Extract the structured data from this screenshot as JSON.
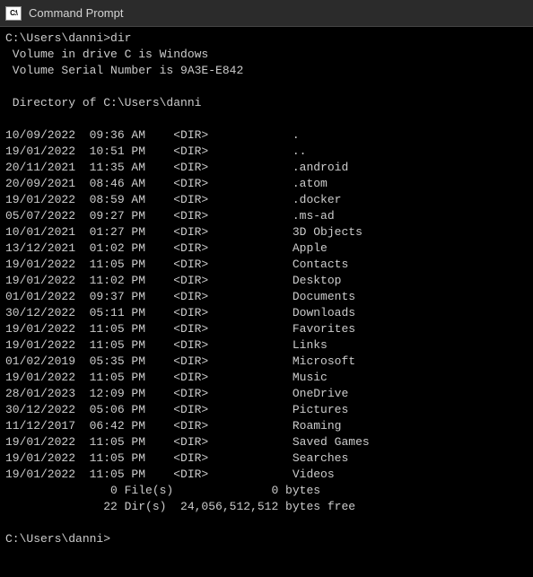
{
  "window": {
    "title": "Command Prompt",
    "icon_glyph": "C:\\"
  },
  "prompt1": {
    "path": "C:\\Users\\danni>",
    "command": "dir"
  },
  "volume_line": " Volume in drive C is Windows",
  "serial_line": " Volume Serial Number is 9A3E-E842",
  "directory_line": " Directory of C:\\Users\\danni",
  "entries": [
    {
      "date": "10/09/2022",
      "time": "09:36 AM",
      "type": "<DIR>",
      "name": "."
    },
    {
      "date": "19/01/2022",
      "time": "10:51 PM",
      "type": "<DIR>",
      "name": ".."
    },
    {
      "date": "20/11/2021",
      "time": "11:35 AM",
      "type": "<DIR>",
      "name": ".android"
    },
    {
      "date": "20/09/2021",
      "time": "08:46 AM",
      "type": "<DIR>",
      "name": ".atom"
    },
    {
      "date": "19/01/2022",
      "time": "08:59 AM",
      "type": "<DIR>",
      "name": ".docker"
    },
    {
      "date": "05/07/2022",
      "time": "09:27 PM",
      "type": "<DIR>",
      "name": ".ms-ad"
    },
    {
      "date": "10/01/2021",
      "time": "01:27 PM",
      "type": "<DIR>",
      "name": "3D Objects"
    },
    {
      "date": "13/12/2021",
      "time": "01:02 PM",
      "type": "<DIR>",
      "name": "Apple"
    },
    {
      "date": "19/01/2022",
      "time": "11:05 PM",
      "type": "<DIR>",
      "name": "Contacts"
    },
    {
      "date": "19/01/2022",
      "time": "11:02 PM",
      "type": "<DIR>",
      "name": "Desktop"
    },
    {
      "date": "01/01/2022",
      "time": "09:37 PM",
      "type": "<DIR>",
      "name": "Documents"
    },
    {
      "date": "30/12/2022",
      "time": "05:11 PM",
      "type": "<DIR>",
      "name": "Downloads"
    },
    {
      "date": "19/01/2022",
      "time": "11:05 PM",
      "type": "<DIR>",
      "name": "Favorites"
    },
    {
      "date": "19/01/2022",
      "time": "11:05 PM",
      "type": "<DIR>",
      "name": "Links"
    },
    {
      "date": "01/02/2019",
      "time": "05:35 PM",
      "type": "<DIR>",
      "name": "Microsoft"
    },
    {
      "date": "19/01/2022",
      "time": "11:05 PM",
      "type": "<DIR>",
      "name": "Music"
    },
    {
      "date": "28/01/2023",
      "time": "12:09 PM",
      "type": "<DIR>",
      "name": "OneDrive"
    },
    {
      "date": "30/12/2022",
      "time": "05:06 PM",
      "type": "<DIR>",
      "name": "Pictures"
    },
    {
      "date": "11/12/2017",
      "time": "06:42 PM",
      "type": "<DIR>",
      "name": "Roaming"
    },
    {
      "date": "19/01/2022",
      "time": "11:05 PM",
      "type": "<DIR>",
      "name": "Saved Games"
    },
    {
      "date": "19/01/2022",
      "time": "11:05 PM",
      "type": "<DIR>",
      "name": "Searches"
    },
    {
      "date": "19/01/2022",
      "time": "11:05 PM",
      "type": "<DIR>",
      "name": "Videos"
    }
  ],
  "summary_files": "               0 File(s)              0 bytes",
  "summary_dirs": "              22 Dir(s)  24,056,512,512 bytes free",
  "prompt2": {
    "path": "C:\\Users\\danni>"
  }
}
